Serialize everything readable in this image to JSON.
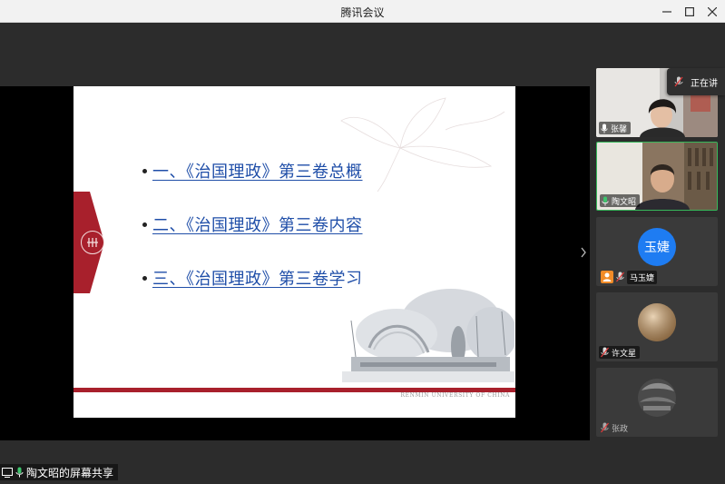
{
  "window": {
    "title": "腾讯会议"
  },
  "slide": {
    "items": [
      {
        "label": "一、《治国理政》第三卷总概"
      },
      {
        "label": "二、《治国理政》第三卷内容"
      },
      {
        "label": "三、《治国理政》第三卷学习"
      }
    ],
    "footer_text": "RENMIN UNIVERSITY OF CHINA"
  },
  "share_label": "陶文昭的屏幕共享",
  "speaking_indicator": "正在讲",
  "participants": [
    {
      "name": "张馨",
      "mic": "mic-on-icon",
      "video": true
    },
    {
      "name": "陶文昭",
      "mic": "mic-on-icon",
      "video": true,
      "active_speaker": true
    },
    {
      "name": "马玉婕",
      "mic": "mic-muted-icon",
      "avatar_text": "玉婕",
      "host": true
    },
    {
      "name": "许文星",
      "mic": "mic-muted-icon",
      "video": false
    },
    {
      "name": "张政",
      "mic": "mic-muted-icon",
      "video": false
    }
  ],
  "colors": {
    "link": "#1f4ea8",
    "brand_red": "#a8202c",
    "active_border": "#36b85a",
    "avatar_blue": "#1e7cf2"
  }
}
